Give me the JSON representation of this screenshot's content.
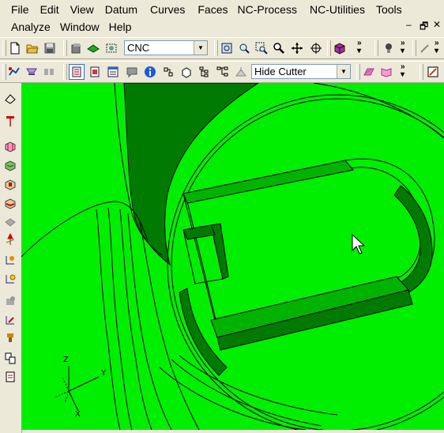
{
  "menu": {
    "row1": [
      {
        "label": "File"
      },
      {
        "label": "Edit"
      },
      {
        "label": "View"
      },
      {
        "label": "Datum"
      },
      {
        "label": "Curves"
      },
      {
        "label": "Faces"
      },
      {
        "label": "NC-Process"
      },
      {
        "label": "NC-Utilities"
      },
      {
        "label": "Tools"
      }
    ],
    "row2": [
      {
        "label": "Analyze"
      },
      {
        "label": "Window"
      },
      {
        "label": "Help"
      }
    ]
  },
  "window_controls": {
    "minimize": "–",
    "restore": "🗗",
    "close": "✕"
  },
  "toolbar1": {
    "mode_combo": {
      "value": "CNC"
    }
  },
  "toolbar2": {
    "cutter_combo": {
      "value": "Hide Cutter"
    }
  },
  "triad": {
    "z": "Z",
    "x": "X",
    "y": "Y"
  },
  "colors": {
    "viewport_bg": "#00ee00",
    "face_dark": "#007a00",
    "face_mid": "#00b300",
    "ui_bg": "#ece9d8"
  }
}
